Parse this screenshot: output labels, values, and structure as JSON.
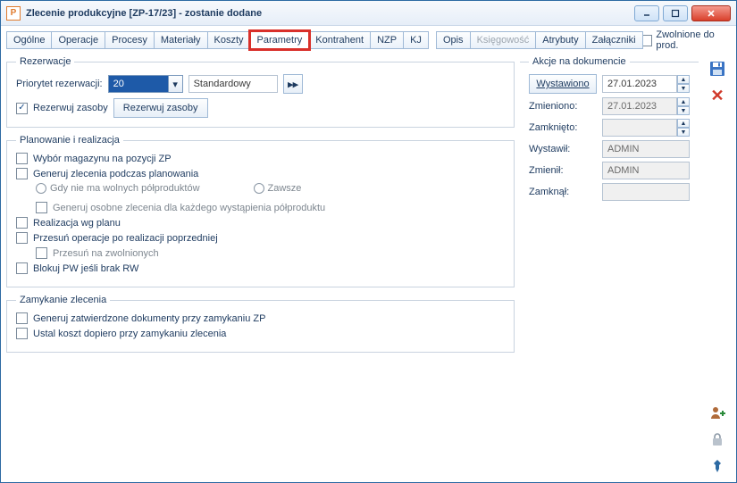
{
  "window": {
    "title": "Zlecenie produkcyjne  [ZP-17/23] - zostanie dodane",
    "app_icon_letter": "P"
  },
  "tabs": {
    "ogolne": "Ogólne",
    "operacje": "Operacje",
    "procesy": "Procesy",
    "materialy": "Materiały",
    "koszty": "Koszty",
    "parametry": "Parametry",
    "kontrahent": "Kontrahent",
    "nzp": "NZP",
    "kj": "KJ",
    "opis": "Opis",
    "ksiegowosc": "Księgowość",
    "atrybuty": "Atrybuty",
    "zalaczniki": "Załączniki"
  },
  "zwolnione_label": "Zwolnione do prod.",
  "rezerwacje": {
    "legend": "Rezerwacje",
    "priorytet_label": "Priorytet rezerwacji:",
    "priorytet_value": "20",
    "standardowy": "Standardowy",
    "rezerwuj_zasoby_chk": "Rezerwuj zasoby",
    "rezerwuj_zasoby_btn": "Rezerwuj zasoby"
  },
  "planowanie": {
    "legend": "Planowanie i realizacja",
    "wybor_magazynu": "Wybór magazynu na pozycji ZP",
    "generuj_zlecenia": "Generuj zlecenia podczas planowania",
    "gdy_nie_ma": "Gdy nie ma wolnych półproduktów",
    "zawsze": "Zawsze",
    "generuj_osobne": "Generuj osobne zlecenia dla każdego wystąpienia półproduktu",
    "realizacja_wg": "Realizacja wg planu",
    "przesun_operacje": "Przesuń operacje po realizacji poprzedniej",
    "przesun_na_zwol": "Przesuń na zwolnionych",
    "blokuj_pw": "Blokuj PW jeśli brak RW"
  },
  "zamykanie": {
    "legend": "Zamykanie zlecenia",
    "generuj_zatw": "Generuj zatwierdzone dokumenty przy zamykaniu ZP",
    "ustal_koszt": "Ustal koszt dopiero przy zamykaniu zlecenia"
  },
  "akcje": {
    "legend": "Akcje na dokumencie",
    "wystawiono_btn": "Wystawiono",
    "wystawiono_date": "27.01.2023",
    "zmieniono_label": "Zmieniono:",
    "zmieniono_date": "27.01.2023",
    "zamknieto_label": "Zamknięto:",
    "zamknieto_date": "",
    "wystawil_label": "Wystawił:",
    "wystawil_value": "ADMIN",
    "zmienil_label": "Zmienił:",
    "zmienil_value": "ADMIN",
    "zamknal_label": "Zamknął:",
    "zamknal_value": ""
  }
}
